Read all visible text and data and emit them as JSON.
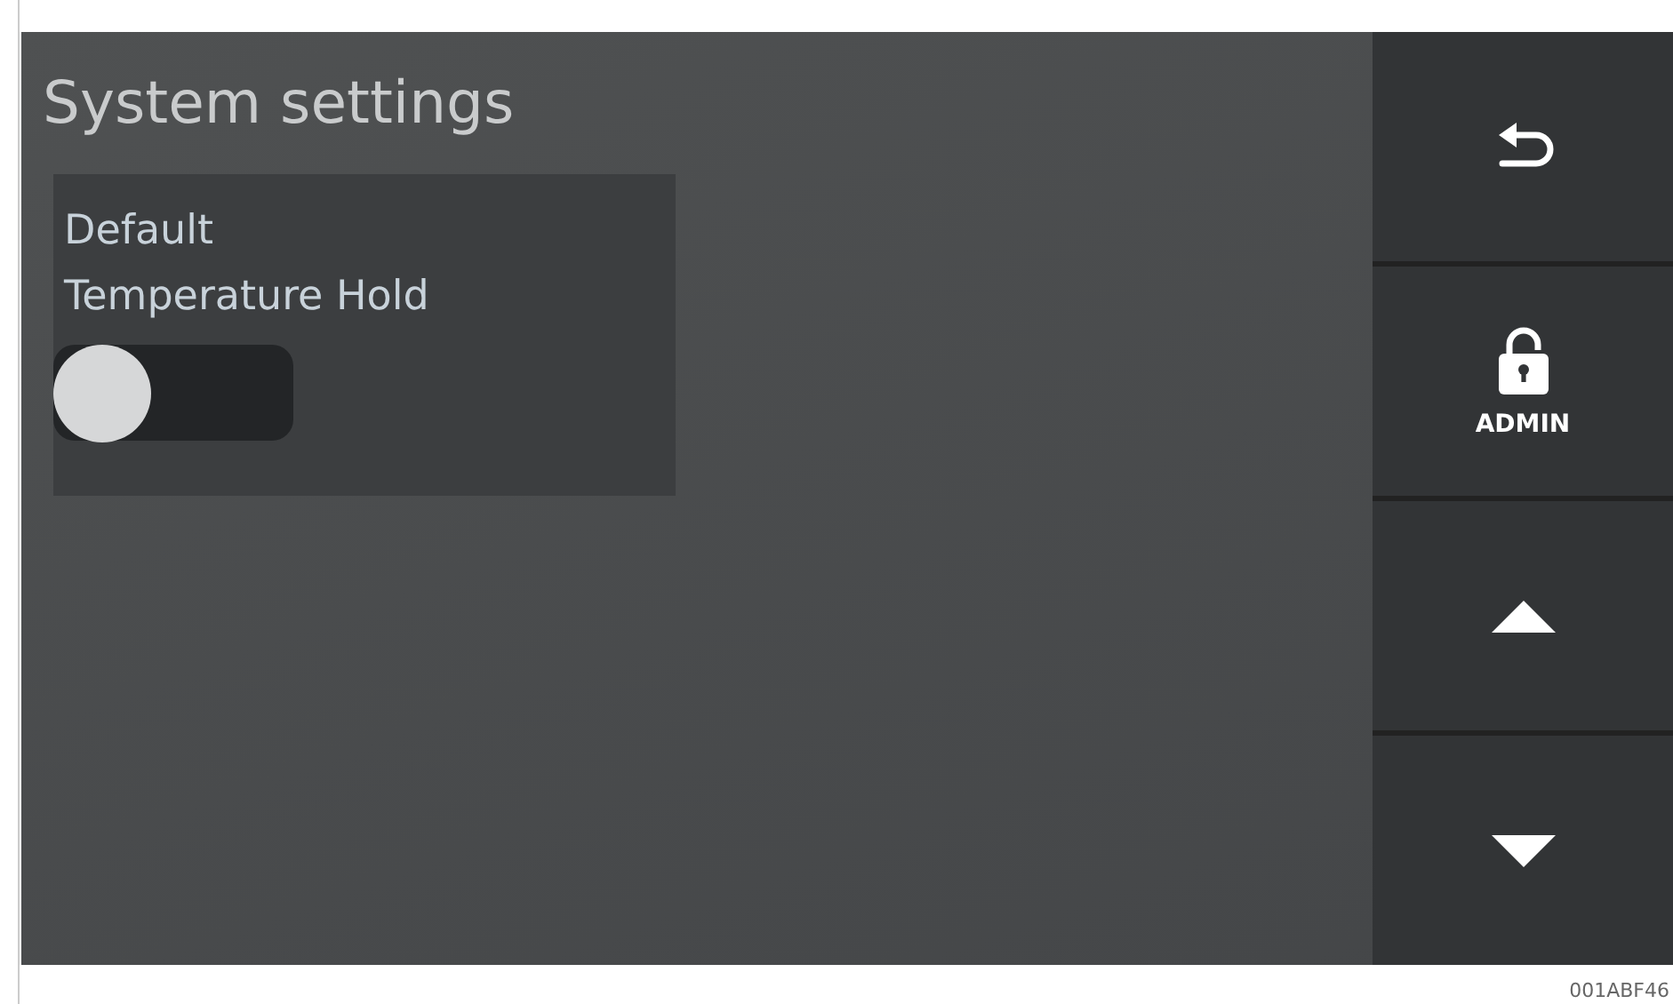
{
  "screen": {
    "title": "System settings"
  },
  "settings": [
    {
      "kind": "toggle",
      "label_lines": [
        "Default",
        "Temperature Hold"
      ],
      "on": false
    }
  ],
  "sidebar": {
    "buttons": [
      {
        "kind": "back"
      },
      {
        "kind": "lock",
        "label": "ADMIN"
      },
      {
        "kind": "up"
      },
      {
        "kind": "down"
      }
    ]
  },
  "figure_id": "001ABF46"
}
